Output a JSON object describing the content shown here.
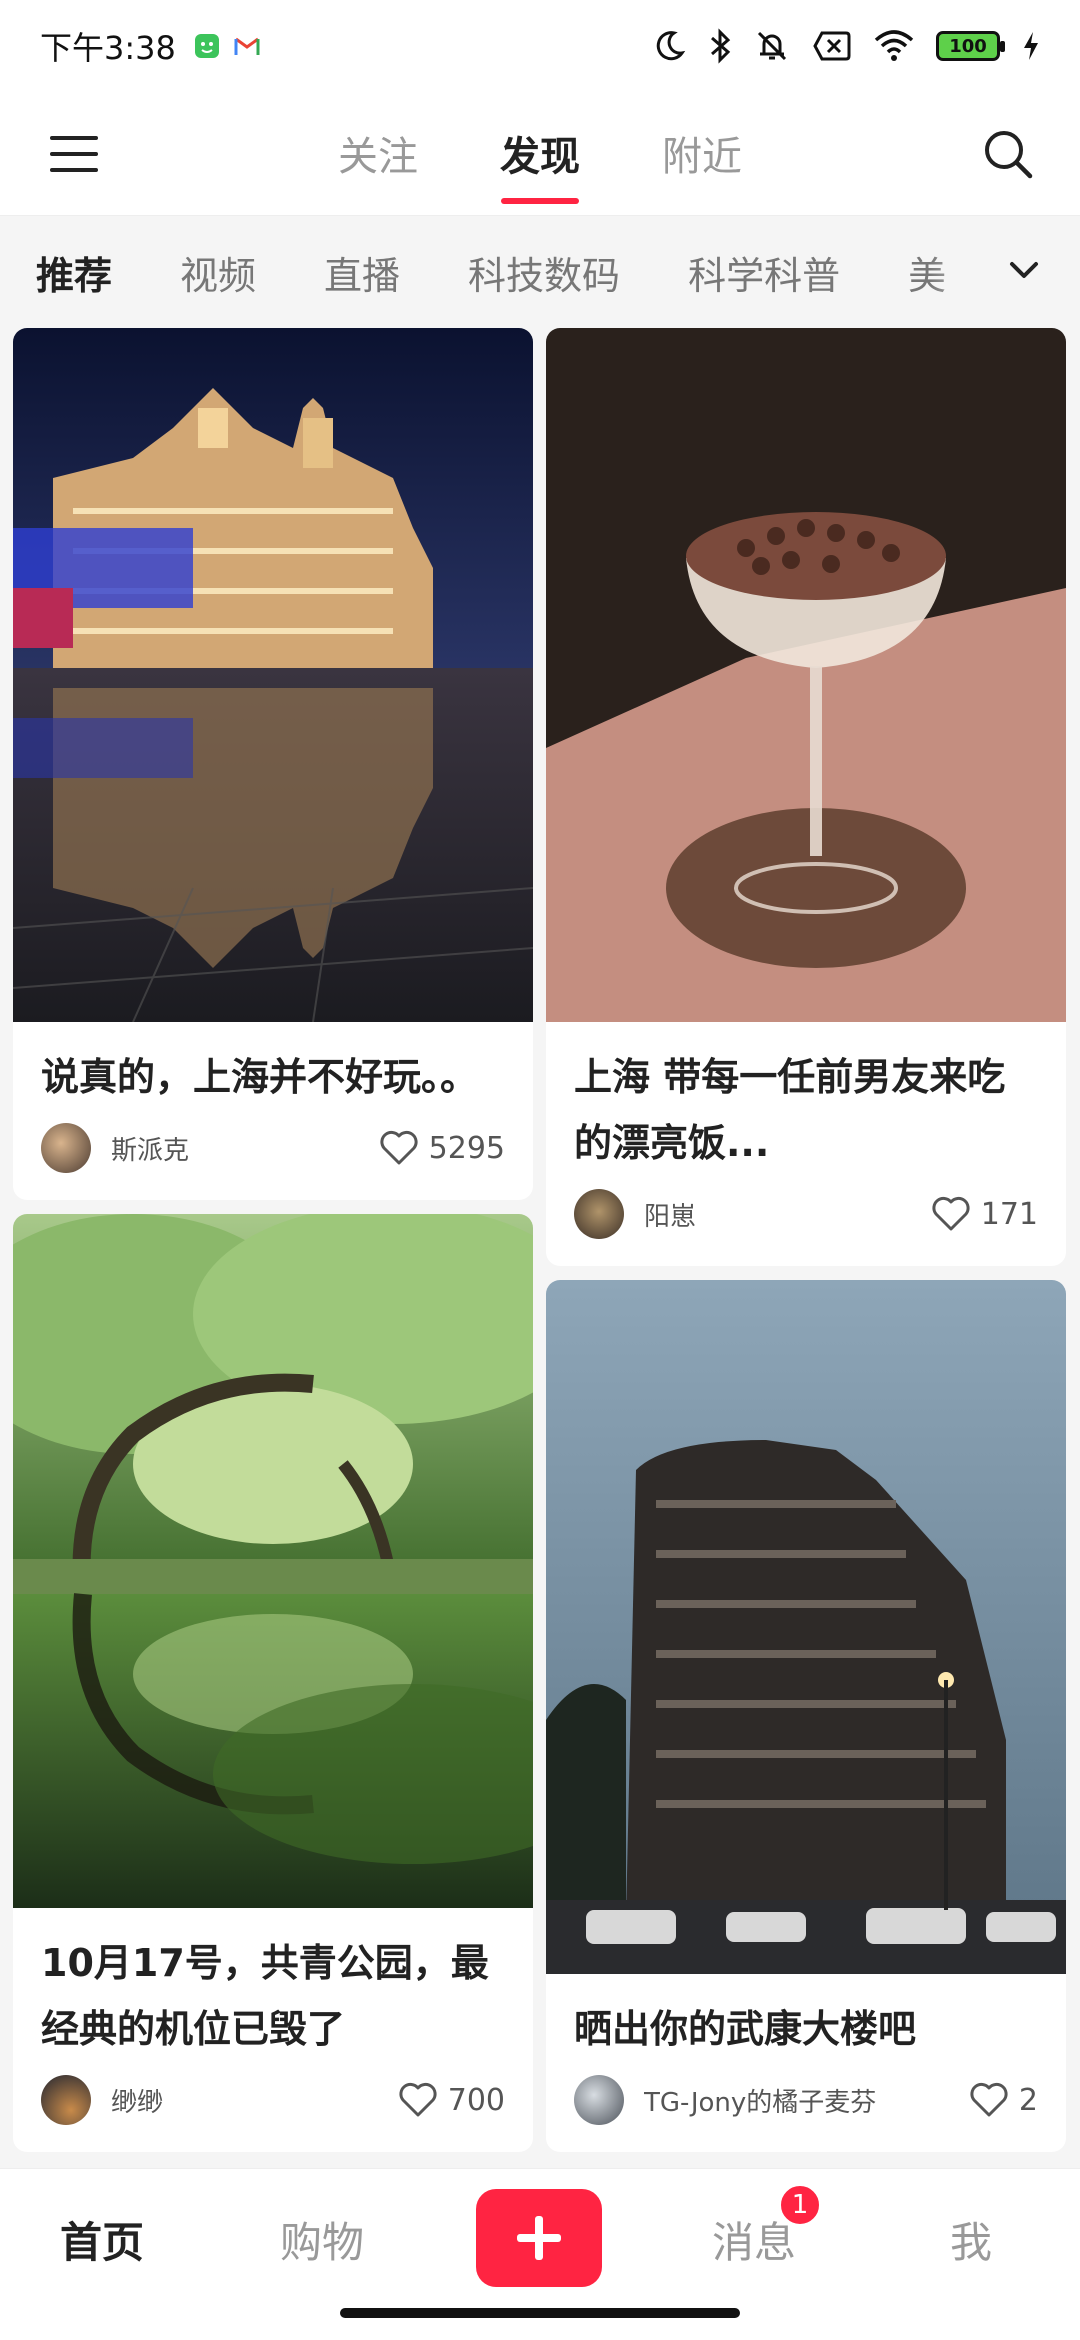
{
  "status_bar": {
    "time": "下午3:38",
    "battery": "100"
  },
  "top_nav": {
    "tabs": [
      {
        "label": "关注"
      },
      {
        "label": "发现"
      },
      {
        "label": "附近"
      }
    ],
    "active_tab": "发现"
  },
  "categories": {
    "items": [
      "推荐",
      "视频",
      "直播",
      "科技数码",
      "科学科普",
      "美"
    ],
    "active": "推荐"
  },
  "feed": {
    "left": [
      {
        "title": "说真的，上海并不好玩。。",
        "author": "斯派克",
        "likes": "5295"
      },
      {
        "title": "10月17号，共青公园，最经典的机位已毁了",
        "author": "缈缈",
        "likes": "700"
      }
    ],
    "right": [
      {
        "title": "上海 带每一任前男友来吃的漂亮饭...",
        "author": "阳崽",
        "likes": "171"
      },
      {
        "title": "晒出你的武康大楼吧",
        "author": "TG-Jony的橘子麦芬",
        "likes": "2"
      }
    ]
  },
  "bottom_nav": {
    "items": [
      "首页",
      "购物",
      "消息",
      "我"
    ],
    "active": "首页",
    "messages_badge": "1"
  },
  "colors": {
    "accent": "#ff2442",
    "background": "#f5f5f5"
  },
  "icons": [
    "menu-icon",
    "search-icon",
    "chevron-down-icon",
    "heart-icon",
    "plus-icon",
    "moon-icon",
    "bluetooth-icon",
    "bell-off-icon",
    "wifi-icon",
    "battery-icon",
    "charging-icon"
  ]
}
